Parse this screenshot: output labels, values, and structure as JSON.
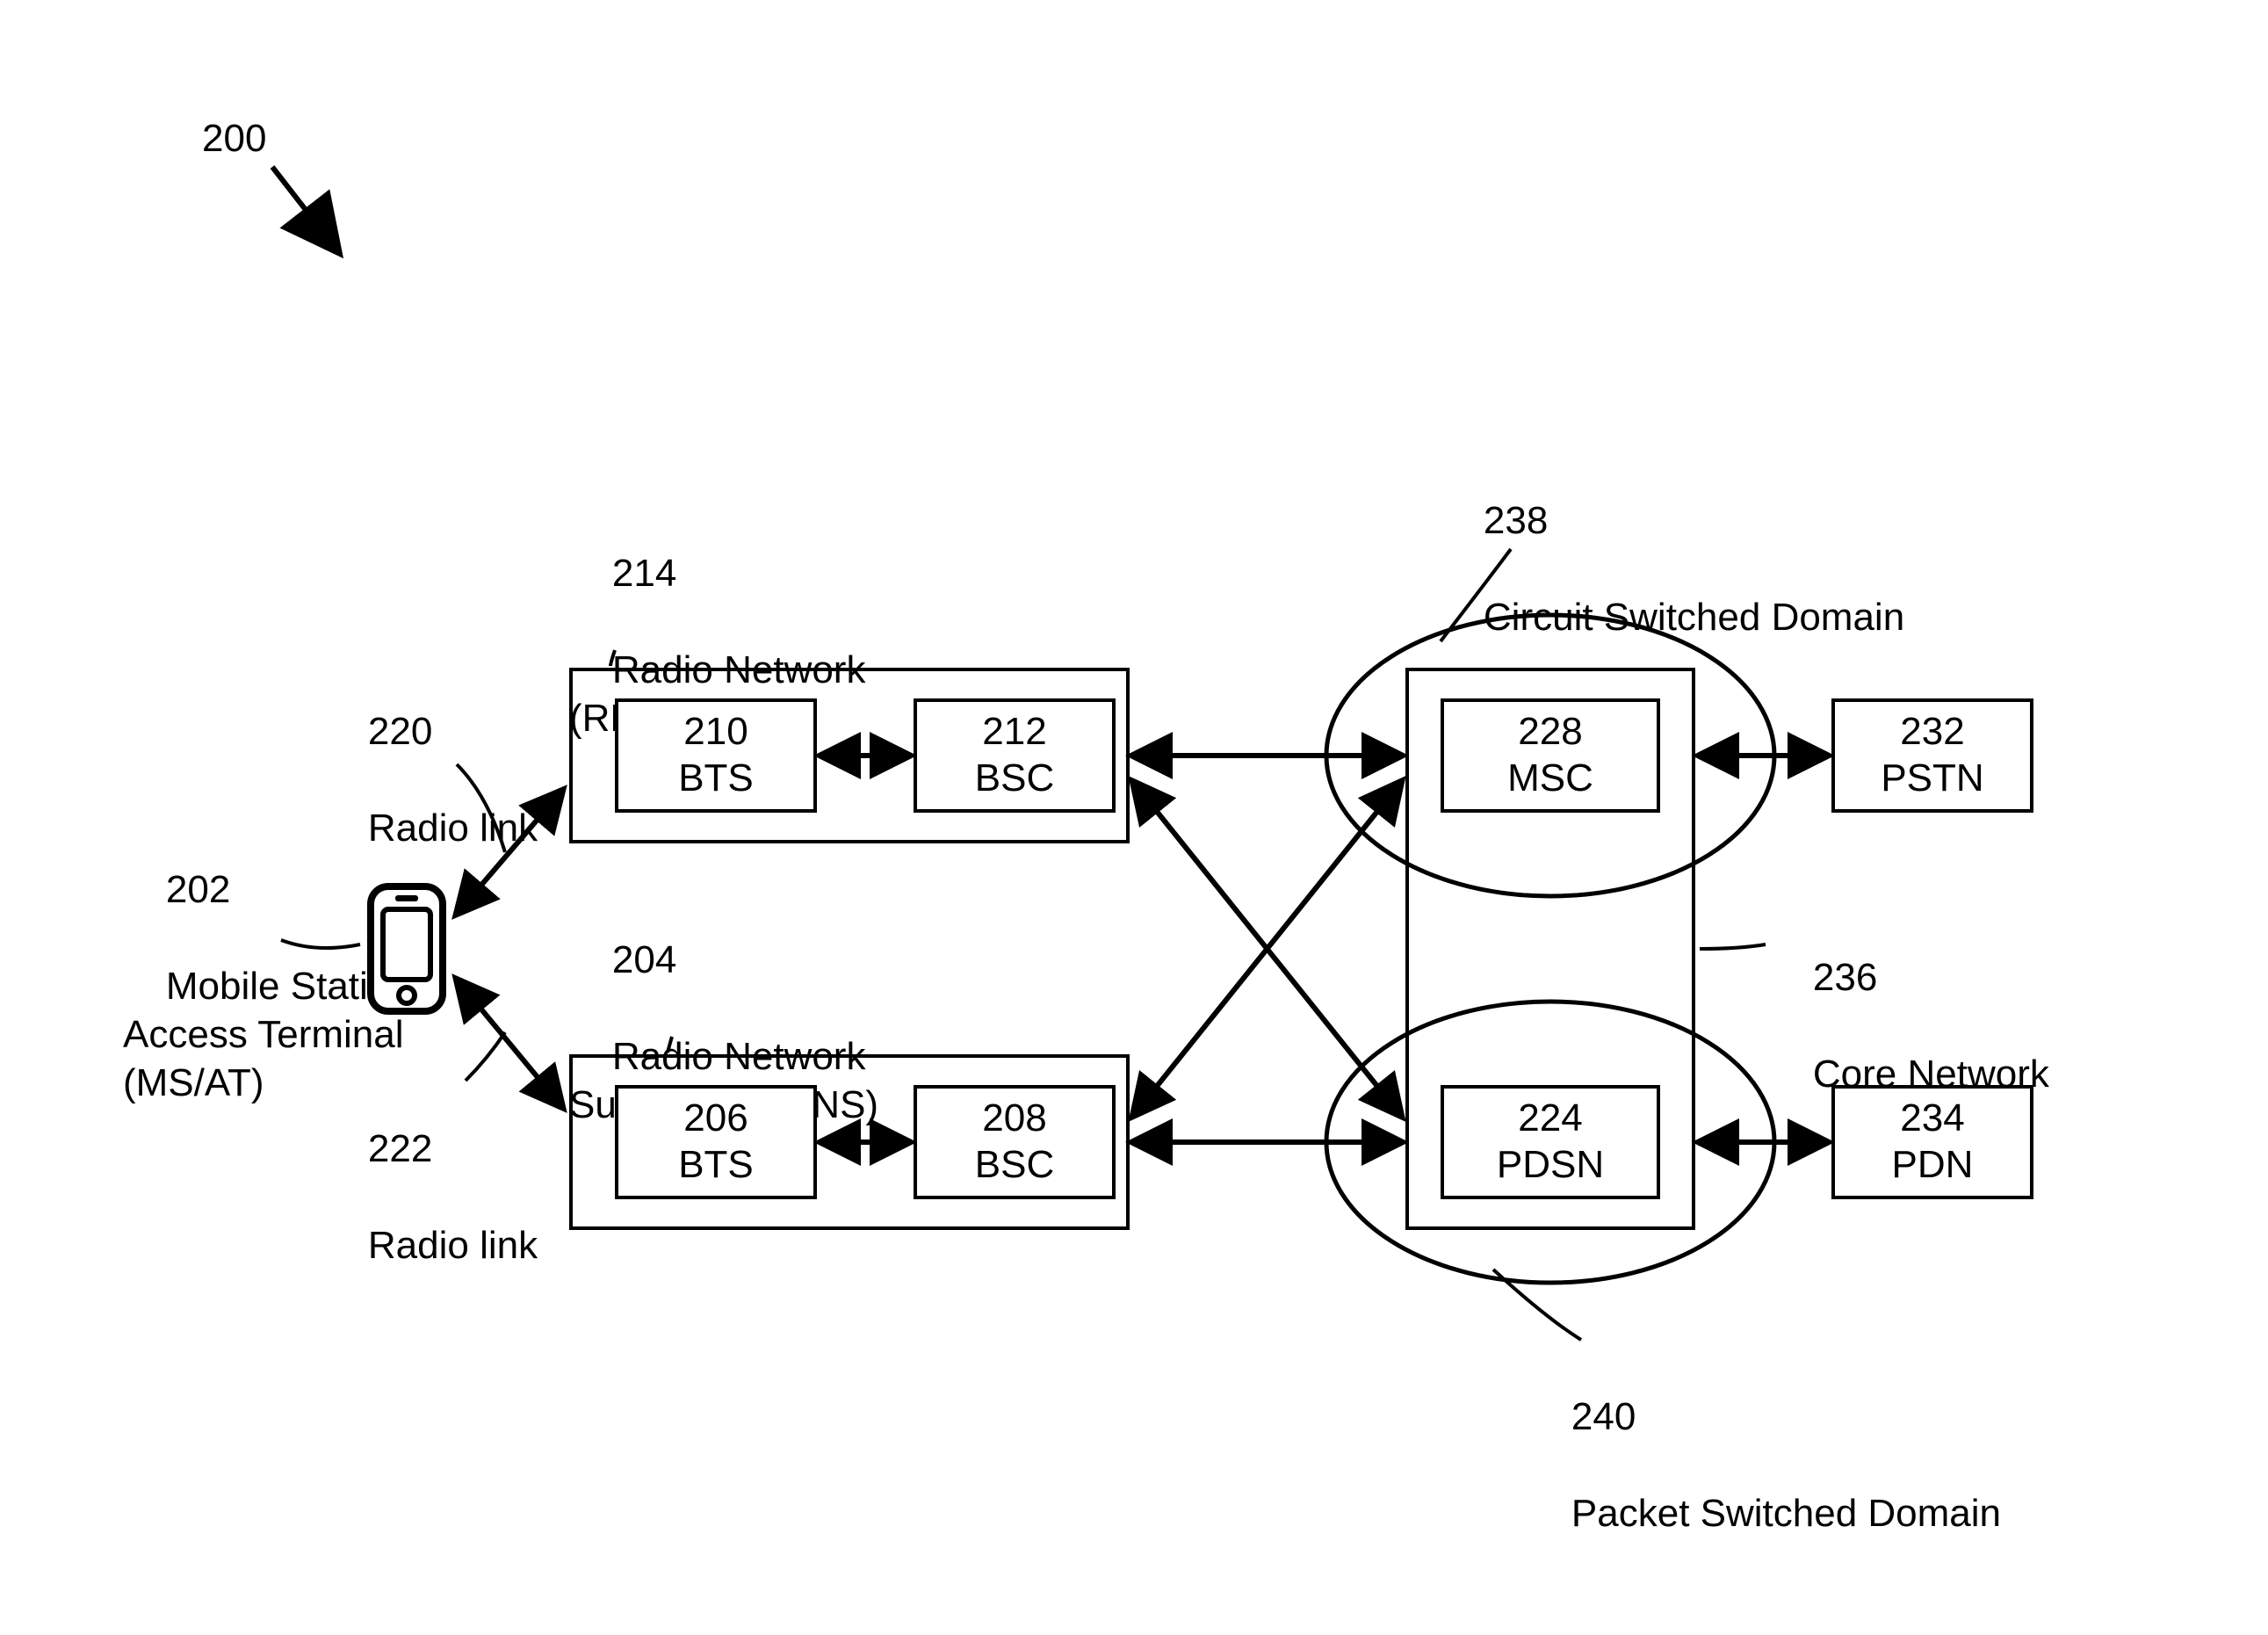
{
  "figure_ref": "200",
  "ms_at": {
    "ref": "202",
    "name": "Mobile Station/\nAccess Terminal\n(MS/AT)"
  },
  "radio_links": {
    "top": {
      "ref": "220",
      "name": "Radio link"
    },
    "bottom": {
      "ref": "222",
      "name": "Radio link"
    }
  },
  "rns_top": {
    "ref": "214",
    "name": "Radio Network\n(RNS)",
    "bts": {
      "ref": "210",
      "name": "BTS"
    },
    "bsc": {
      "ref": "212",
      "name": "BSC"
    }
  },
  "rns_bottom": {
    "ref": "204",
    "name": "Radio Network\nSubsystem (RNS)",
    "bts": {
      "ref": "206",
      "name": "BTS"
    },
    "bsc": {
      "ref": "208",
      "name": "BSC"
    }
  },
  "core": {
    "ref": "236",
    "name": "Core Network",
    "msc": {
      "ref": "228",
      "name": "MSC"
    },
    "pdsn": {
      "ref": "224",
      "name": "PDSN"
    }
  },
  "cs_domain": {
    "ref": "238",
    "name": "Circuit Switched Domain"
  },
  "ps_domain": {
    "ref": "240",
    "name": "Packet Switched Domain"
  },
  "pstn": {
    "ref": "232",
    "name": "PSTN"
  },
  "pdn": {
    "ref": "234",
    "name": "PDN"
  }
}
